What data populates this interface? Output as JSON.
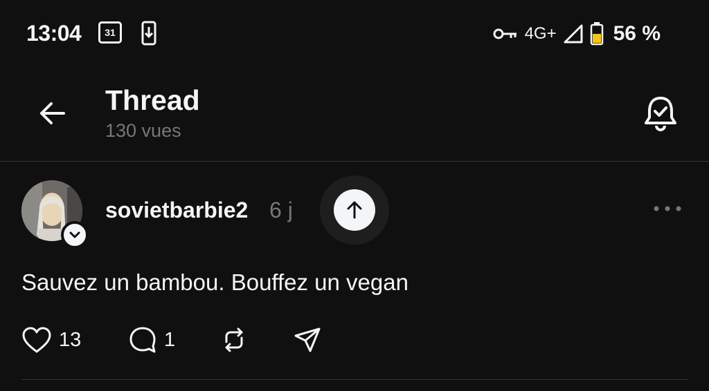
{
  "status_bar": {
    "time": "13:04",
    "calendar_day": "31",
    "network": "4G+",
    "battery": "56 %"
  },
  "header": {
    "title": "Thread",
    "views": "130 vues"
  },
  "post": {
    "username": "sovietbarbie2",
    "time_ago": "6 j",
    "text": "Sauvez un bambou. Bouffez un vegan",
    "like_count": "13",
    "reply_count": "1"
  },
  "colors": {
    "background": "#101010",
    "text": "#f3f5f7",
    "muted": "#777777",
    "battery_fill": "#f5c518"
  }
}
